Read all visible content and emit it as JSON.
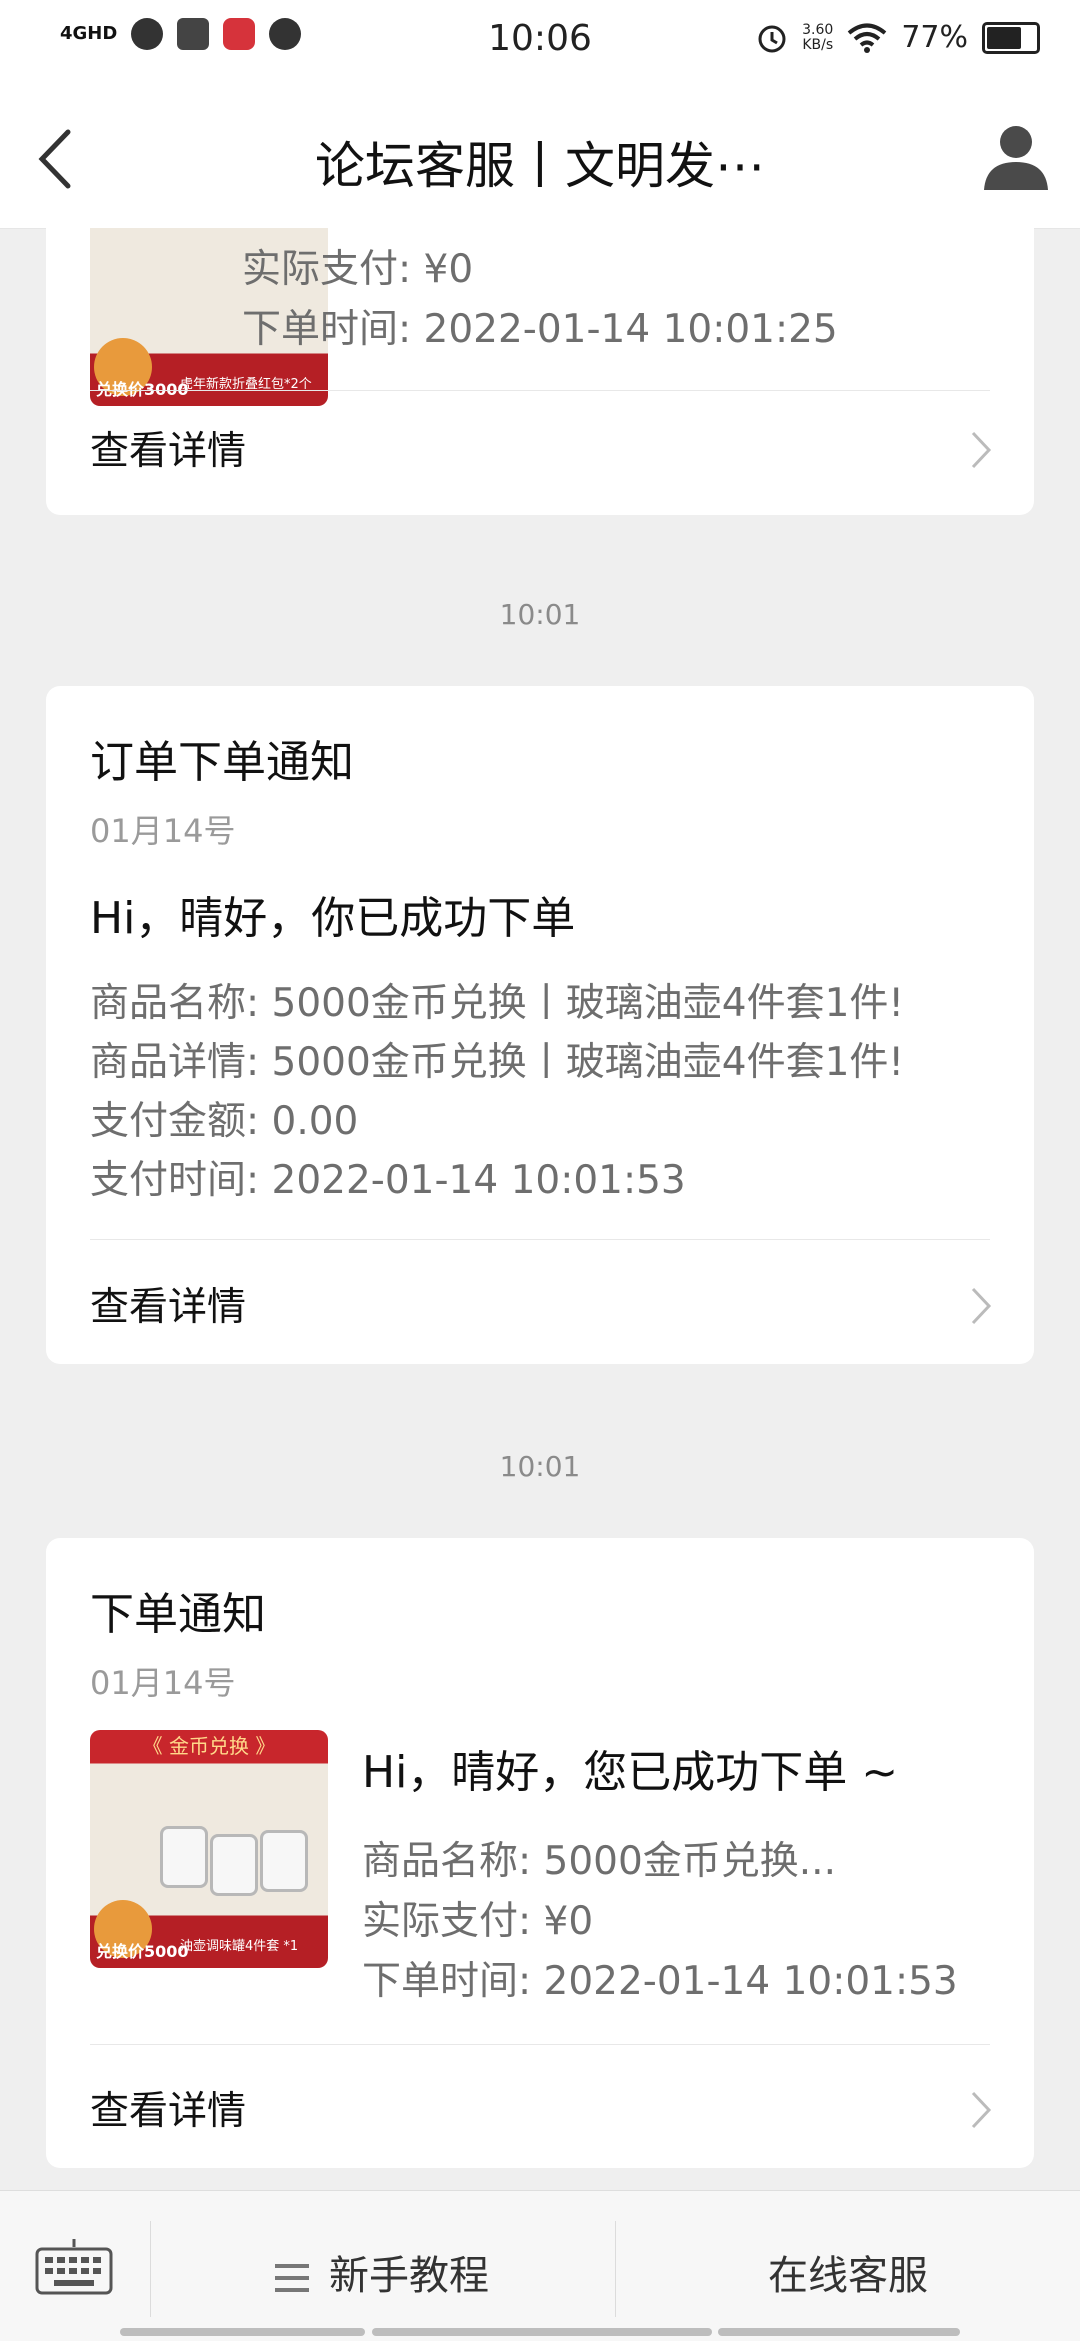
{
  "status_bar": {
    "network": "4GHD",
    "time": "10:06",
    "speed": "3.60",
    "speed_unit": "KB/s",
    "battery": "77%",
    "battery_level": 0.77
  },
  "nav": {
    "title": "论坛客服丨文明发⋯"
  },
  "cards": [
    {
      "id": "card-0",
      "lines": [
        "实际支付: ¥0",
        "下单时间: 2022-01-14 10:01:25"
      ],
      "detail_label": "查看详情",
      "thumb": {
        "price_tag": "兑换价3000",
        "caption": "虎年新款折叠红包*2个"
      }
    },
    {
      "id": "card-1",
      "time_label": "10:01",
      "title": "订单下单通知",
      "date": "01月14号",
      "greeting": "Hi，晴好，你已成功下单",
      "lines": [
        "商品名称: 5000金币兑换丨玻璃油壶4件套1件!",
        "商品详情: 5000金币兑换丨玻璃油壶4件套1件!",
        "支付金额: 0.00",
        "支付时间: 2022-01-14 10:01:53"
      ],
      "detail_label": "查看详情"
    },
    {
      "id": "card-2",
      "time_label": "10:01",
      "title": "下单通知",
      "date": "01月14号",
      "greeting": "Hi，晴好，您已成功下单 ~",
      "lines": [
        "商品名称: 5000金币兑换...",
        "实际支付: ¥0",
        "下单时间: 2022-01-14 10:01:53"
      ],
      "detail_label": "查看详情",
      "thumb": {
        "banner": "《 金币兑换 》",
        "price_tag": "兑换价5000",
        "caption": "油壶调味罐4件套 *1"
      }
    }
  ],
  "bottom_bar": {
    "menu_label": "新手教程",
    "service_label": "在线客服"
  }
}
